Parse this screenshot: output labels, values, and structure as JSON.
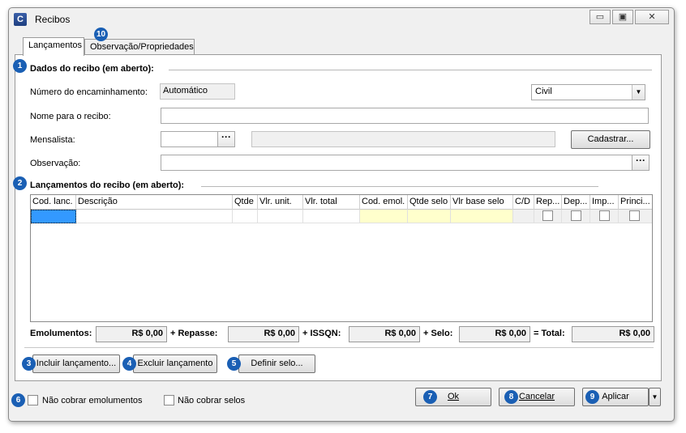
{
  "window": {
    "title": "Recibos",
    "icon_letter": "C"
  },
  "titlebar_buttons": {
    "minimize": "▭",
    "maximize": "▣",
    "close": "✕"
  },
  "tabs": [
    {
      "label": "Lançamentos"
    },
    {
      "label": "Observação/Propriedades"
    }
  ],
  "badges": [
    "1",
    "2",
    "3",
    "4",
    "5",
    "6",
    "7",
    "8",
    "9",
    "10"
  ],
  "dados": {
    "title": "Dados do recibo (em aberto):",
    "numero_label": "Número do encaminhamento:",
    "numero_value": "Automático",
    "tipo_value": "Civil",
    "nome_label": "Nome para o recibo:",
    "nome_value": "",
    "mensalista_label": "Mensalista:",
    "mensalista_code": "",
    "mensalista_name": "",
    "cadastrar_label": "Cadastrar...",
    "observacao_label": "Observação:",
    "observacao_value": "",
    "dots": "···"
  },
  "lancamentos": {
    "title": "Lançamentos do recibo (em aberto):",
    "columns": [
      "Cod. lanc.",
      "Descrição",
      "Qtde",
      "Vlr. unit.",
      "Vlr. total",
      "Cod. emol.",
      "Qtde selo",
      "Vlr base selo",
      "C/D",
      "Rep...",
      "Dep...",
      "Imp...",
      "Princi..."
    ]
  },
  "totals": {
    "emolumentos_label": "Emolumentos:",
    "emolumentos_value": "R$ 0,00",
    "repasse_label": "+ Repasse:",
    "repasse_value": "R$ 0,00",
    "issqn_label": "+ ISSQN:",
    "issqn_value": "R$ 0,00",
    "selo_label": "+ Selo:",
    "selo_value": "R$ 0,00",
    "total_label": "= Total:",
    "total_value": "R$ 0,00"
  },
  "actions": {
    "incluir": "Incluir lançamento...",
    "excluir": "Excluir lançamento",
    "definir": "Definir selo..."
  },
  "footer": {
    "nao_cobrar_emolumentos": "Não cobrar emolumentos",
    "nao_cobrar_selos": "Não cobrar selos",
    "ok": "Ok",
    "cancelar": "Cancelar",
    "aplicar": "Aplicar"
  }
}
